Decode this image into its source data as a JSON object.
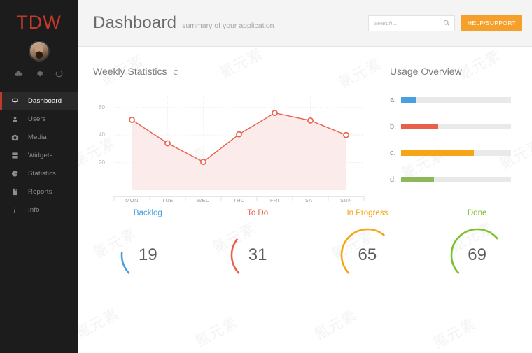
{
  "brand": {
    "logo": "TDW",
    "logo_color": "#c0392b"
  },
  "sidebar": {
    "avatar_name": "user-avatar",
    "util_icons": [
      {
        "name": "cloud-icon"
      },
      {
        "name": "gear-icon"
      },
      {
        "name": "power-icon"
      }
    ],
    "items": [
      {
        "label": "Dashboard",
        "icon": "monitor-icon",
        "active": true
      },
      {
        "label": "Users",
        "icon": "user-icon",
        "active": false
      },
      {
        "label": "Media",
        "icon": "camera-icon",
        "active": false
      },
      {
        "label": "Widgets",
        "icon": "grid-icon",
        "active": false
      },
      {
        "label": "Statistics",
        "icon": "pie-chart-icon",
        "active": false
      },
      {
        "label": "Reports",
        "icon": "document-icon",
        "active": false
      },
      {
        "label": "Info",
        "icon": "info-icon",
        "active": false
      }
    ]
  },
  "header": {
    "title": "Dashboard",
    "subtitle": "summary of your application",
    "search_placeholder": "search...",
    "search_value": "",
    "search_icon": "search-icon",
    "help_label": "HELP/SUPPORT",
    "help_color": "#f5a02a"
  },
  "chart_data": {
    "type": "line",
    "title": "Weekly Statistics",
    "refresh_icon": "refresh-icon",
    "categories": [
      "MON",
      "TUE",
      "WED",
      "THU",
      "FRI",
      "SAT",
      "SUN"
    ],
    "values": [
      51,
      34,
      20.5,
      40.5,
      56,
      50.5,
      40
    ],
    "series": [
      {
        "name": "Weekly Statistics",
        "values": [
          51,
          34,
          20.5,
          40.5,
          56,
          50.5,
          40
        ]
      }
    ],
    "yticks": [
      20,
      40,
      60
    ],
    "ylim": [
      0,
      70
    ],
    "xlabel": "",
    "ylabel": "",
    "grid": true,
    "legend": "none",
    "line_color": "#e8604c",
    "area_color": "#fbeceb",
    "marker": "open-circle"
  },
  "usage": {
    "title": "Usage Overview",
    "items": [
      {
        "key": "a.",
        "percent": 14,
        "color": "#4a9fe0"
      },
      {
        "key": "b.",
        "percent": 34,
        "color": "#e8604c"
      },
      {
        "key": "c.",
        "percent": 66,
        "color": "#f5a516"
      },
      {
        "key": "d.",
        "percent": 30,
        "color": "#8cb85a"
      }
    ],
    "track_color": "#e9e9e9"
  },
  "gauges": [
    {
      "label": "Backlog",
      "value": "19",
      "percent": 19,
      "color": "#4a9fe0"
    },
    {
      "label": "To Do",
      "value": "31",
      "percent": 31,
      "color": "#e8604c"
    },
    {
      "label": "In Progress",
      "value": "65",
      "percent": 65,
      "color": "#f5a516"
    },
    {
      "label": "Done",
      "value": "69",
      "percent": 69,
      "color": "#7cc02e"
    }
  ],
  "watermark": {
    "text": "氪元素"
  }
}
